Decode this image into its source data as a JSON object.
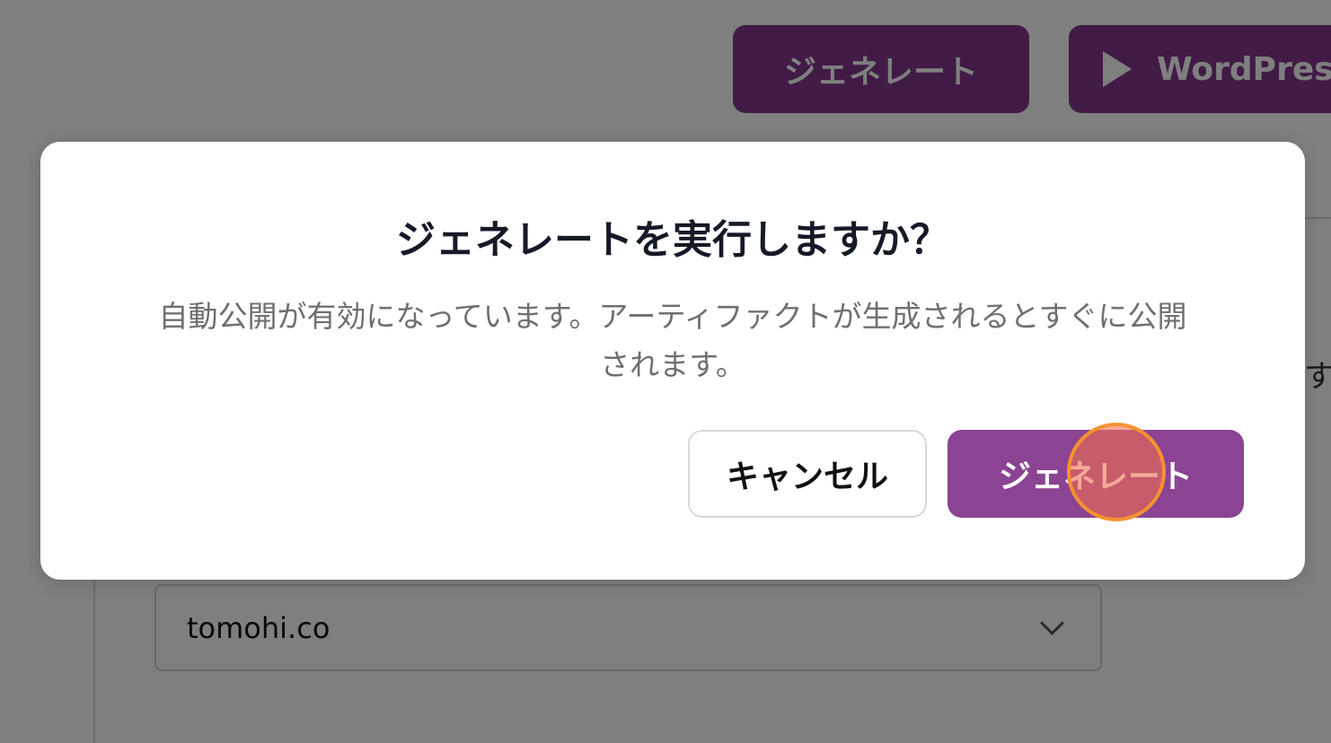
{
  "header": {
    "generate_label": "ジェネレート",
    "publish_label": "WordPress",
    "publish_icon": "play-icon"
  },
  "background": {
    "edge_text": "す",
    "domain_select": {
      "value": "tomohi.co",
      "icon": "chevron-down-icon"
    }
  },
  "dialog": {
    "title": "ジェネレートを実行しますか？",
    "description_line1": "自動公開が有効になっています。アーティファクトが生成されるとすぐに公開",
    "description_line2": "されます。",
    "cancel_label": "キャンセル",
    "confirm_label": "ジェネレート"
  },
  "colors": {
    "brand_purple": "#82378c",
    "confirm_purple": "#8b4393",
    "overlay": "rgba(0,0,0,0.5)",
    "click_marker": "#f5922f"
  }
}
